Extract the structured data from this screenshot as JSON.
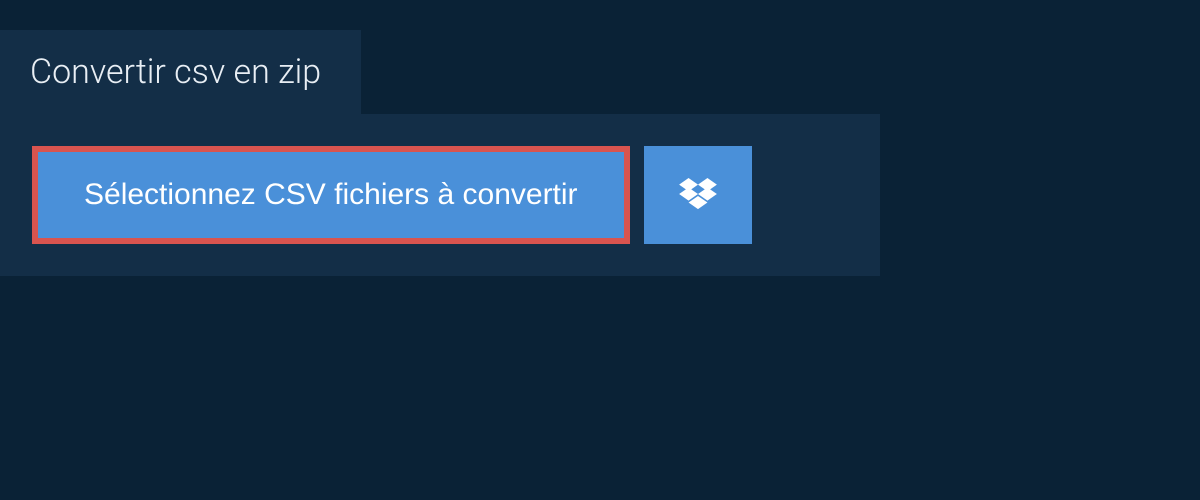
{
  "tab": {
    "title": "Convertir csv en zip"
  },
  "panel": {
    "select_button_label": "Sélectionnez CSV fichiers à convertir"
  },
  "colors": {
    "page_bg": "#0a2236",
    "panel_bg": "#132e47",
    "button_bg": "#4a90d9",
    "highlight_border": "#d9544f",
    "text_light": "#e8eef4"
  }
}
